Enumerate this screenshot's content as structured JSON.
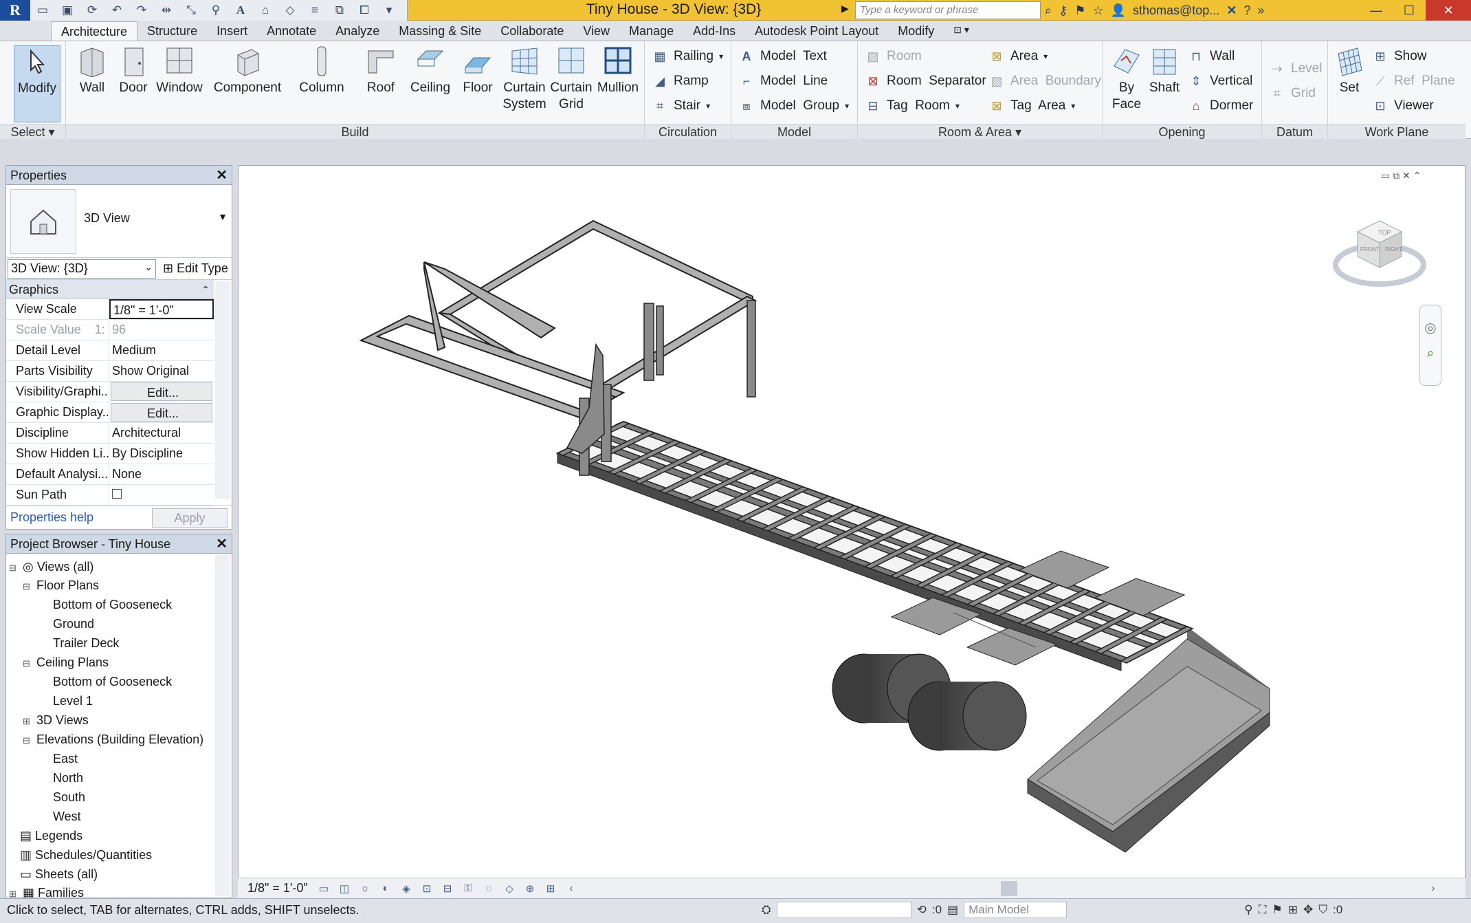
{
  "titlebar": {
    "title": "Tiny House - 3D View: {3D}",
    "search_placeholder": "Type a keyword or phrase",
    "user": "sthomas@top..."
  },
  "tabs": [
    "Architecture",
    "Structure",
    "Insert",
    "Annotate",
    "Analyze",
    "Massing & Site",
    "Collaborate",
    "View",
    "Manage",
    "Add-Ins",
    "Autodesk Point Layout",
    "Modify"
  ],
  "ribbon": {
    "select": {
      "modify": "Modify",
      "title": "Select"
    },
    "build": {
      "wall": "Wall",
      "door": "Door",
      "window": "Window",
      "component": "Component",
      "column": "Column",
      "roof": "Roof",
      "ceiling": "Ceiling",
      "floor": "Floor",
      "curtain_system": "Curtain\nSystem",
      "curtain_grid": "Curtain\nGrid",
      "mullion": "Mullion",
      "title": "Build"
    },
    "circulation": {
      "railing": "Railing",
      "ramp": "Ramp",
      "stair": "Stair",
      "title": "Circulation"
    },
    "model": {
      "text": "Model  Text",
      "line": "Model  Line",
      "group": "Model  Group",
      "title": "Model"
    },
    "room_area": {
      "room": "Room",
      "room_separator": "Room  Separator",
      "tag_room": "Tag  Room",
      "area": "Area",
      "area_boundary": "Area  Boundary",
      "tag_area": "Tag  Area",
      "title": "Room & Area"
    },
    "opening": {
      "by_face": "By\nFace",
      "shaft": "Shaft",
      "wall": "Wall",
      "vertical": "Vertical",
      "dormer": "Dormer",
      "title": "Opening"
    },
    "datum": {
      "level": "Level",
      "grid": "Grid",
      "title": "Datum"
    },
    "work_plane": {
      "set": "Set",
      "show": "Show",
      "ref_plane": "Ref  Plane",
      "viewer": "Viewer",
      "title": "Work Plane"
    }
  },
  "properties": {
    "header": "Properties",
    "type_name": "3D View",
    "instance": "3D View: {3D}",
    "edit_type": "Edit Type",
    "group": "Graphics",
    "rows": [
      {
        "k": "View Scale",
        "v": "1/8\" = 1'-0\""
      },
      {
        "k": "Scale Value    1:",
        "v": "96"
      },
      {
        "k": "Detail Level",
        "v": "Medium"
      },
      {
        "k": "Parts Visibility",
        "v": "Show Original"
      },
      {
        "k": "Visibility/Graphi...",
        "v": "Edit..."
      },
      {
        "k": "Graphic Display...",
        "v": "Edit..."
      },
      {
        "k": "Discipline",
        "v": "Architectural"
      },
      {
        "k": "Show Hidden Li...",
        "v": "By Discipline"
      },
      {
        "k": "Default Analysi...",
        "v": "None"
      },
      {
        "k": "Sun Path",
        "v": ""
      }
    ],
    "help": "Properties help",
    "apply": "Apply"
  },
  "browser": {
    "header": "Project Browser - Tiny House",
    "items": [
      {
        "label": "Views (all)"
      },
      {
        "label": "Floor Plans"
      },
      {
        "label": "Bottom of Gooseneck"
      },
      {
        "label": "Ground"
      },
      {
        "label": "Trailer Deck"
      },
      {
        "label": "Ceiling Plans"
      },
      {
        "label": "Bottom of Gooseneck"
      },
      {
        "label": "Level 1"
      },
      {
        "label": "3D Views"
      },
      {
        "label": "Elevations (Building Elevation)"
      },
      {
        "label": "East"
      },
      {
        "label": "North"
      },
      {
        "label": "South"
      },
      {
        "label": "West"
      },
      {
        "label": "Legends"
      },
      {
        "label": "Schedules/Quantities"
      },
      {
        "label": "Sheets (all)"
      },
      {
        "label": "Families"
      }
    ]
  },
  "viewcube": {
    "top": "TOP",
    "front": "FRONT",
    "right": "RIGHT"
  },
  "view_control": {
    "scale": "1/8\" = 1'-0\""
  },
  "status": {
    "text": "Click to select, TAB for alternates, CTRL adds, SHIFT unselects.",
    "count": ":0",
    "model": "Main Model",
    "filter_count": ":0"
  },
  "colors": {
    "titlebar": "#f1c232",
    "accent": "#1c4c9c"
  }
}
